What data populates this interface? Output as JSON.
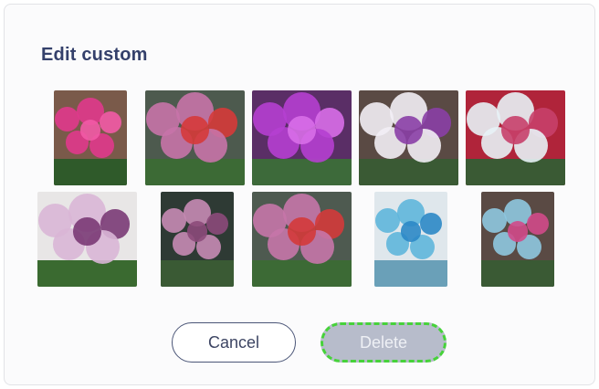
{
  "dialog": {
    "title": "Edit custom",
    "cancel_label": "Cancel",
    "delete_label": "Delete"
  },
  "photos": [
    {
      "name": "photo-pink-orchid-planter",
      "bg": "#7a5a4a",
      "leaf": "#2f5a2a",
      "flower": "#e0388c",
      "accent": "#f25aa6"
    },
    {
      "name": "photo-pink-orchids-greenhouse",
      "bg": "#4d5a4e",
      "leaf": "#3c6a35",
      "flower": "#c873a8",
      "accent": "#d63a3a"
    },
    {
      "name": "photo-purple-orchids",
      "bg": "#5a2e66",
      "leaf": "#3d6a3a",
      "flower": "#b53fd0",
      "accent": "#d86ee8"
    },
    {
      "name": "photo-white-purple-orchids",
      "bg": "#5a4a44",
      "leaf": "#3a5a34",
      "flower": "#f2eef5",
      "accent": "#8a3fa6"
    },
    {
      "name": "photo-red-white-orchids",
      "bg": "#b0243a",
      "leaf": "#3a5a34",
      "flower": "#e8f2f6",
      "accent": "#c8406a"
    },
    {
      "name": "photo-spotted-orchid-spray",
      "bg": "#e8e6e6",
      "leaf": "#3a6a30",
      "flower": "#d9b6d6",
      "accent": "#7a3a76"
    },
    {
      "name": "photo-pink-orchid-stems",
      "bg": "#2e3a34",
      "leaf": "#3a5a34",
      "flower": "#c68bb4",
      "accent": "#8c4a7a"
    },
    {
      "name": "photo-pink-orchids-greenhouse-2",
      "bg": "#4e5a50",
      "leaf": "#3c6a35",
      "flower": "#c676a8",
      "accent": "#d43a3a"
    },
    {
      "name": "photo-blue-orchids",
      "bg": "#dfe7ec",
      "leaf": "#6aa0b8",
      "flower": "#5fb6dc",
      "accent": "#2c88c6"
    },
    {
      "name": "photo-blue-pink-orchids",
      "bg": "#5a4a44",
      "leaf": "#3a5a34",
      "flower": "#8ec8e0",
      "accent": "#d04a8a"
    }
  ]
}
